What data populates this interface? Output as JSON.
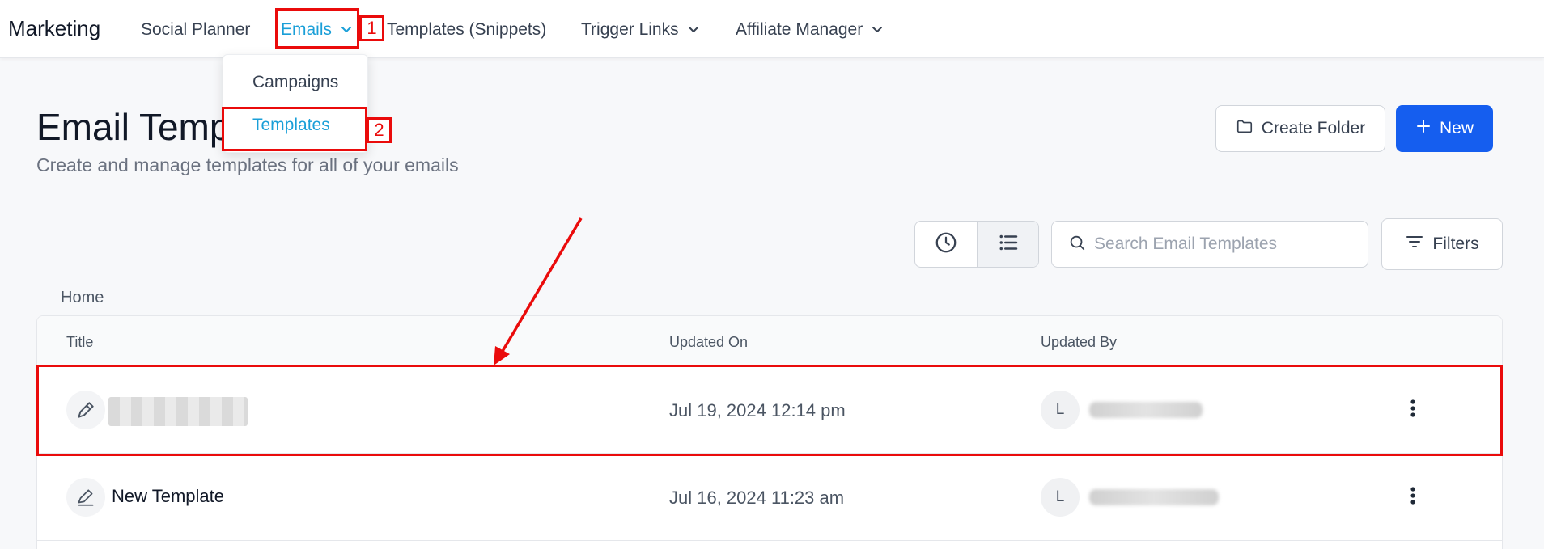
{
  "nav": {
    "brand": "Marketing",
    "items": [
      {
        "label": "Social Planner"
      },
      {
        "label": "Emails"
      },
      {
        "label": "Templates (Snippets)"
      },
      {
        "label": "Trigger Links"
      },
      {
        "label": "Affiliate Manager"
      }
    ]
  },
  "dropdown": {
    "items": [
      {
        "label": "Campaigns"
      },
      {
        "label": "Templates"
      }
    ]
  },
  "page": {
    "title": "Email Templates",
    "subtitle": "Create and manage templates for all of your emails"
  },
  "actions": {
    "create_folder": "Create Folder",
    "new": "New",
    "filters": "Filters"
  },
  "search": {
    "placeholder": "Search Email Templates"
  },
  "breadcrumb": "Home",
  "table": {
    "headers": [
      "Title",
      "Updated On",
      "Updated By"
    ],
    "rows": [
      {
        "title": "",
        "updated_on": "Jul 19, 2024 12:14 pm",
        "avatar": "L"
      },
      {
        "title": "New Template",
        "updated_on": "Jul 16, 2024 11:23 am",
        "avatar": "L"
      }
    ]
  },
  "annotations": {
    "step1": "1",
    "step2": "2"
  },
  "colors": {
    "accent": "#1a9fd8",
    "primary_button": "#155eef",
    "annotation": "#ea0b0b"
  }
}
